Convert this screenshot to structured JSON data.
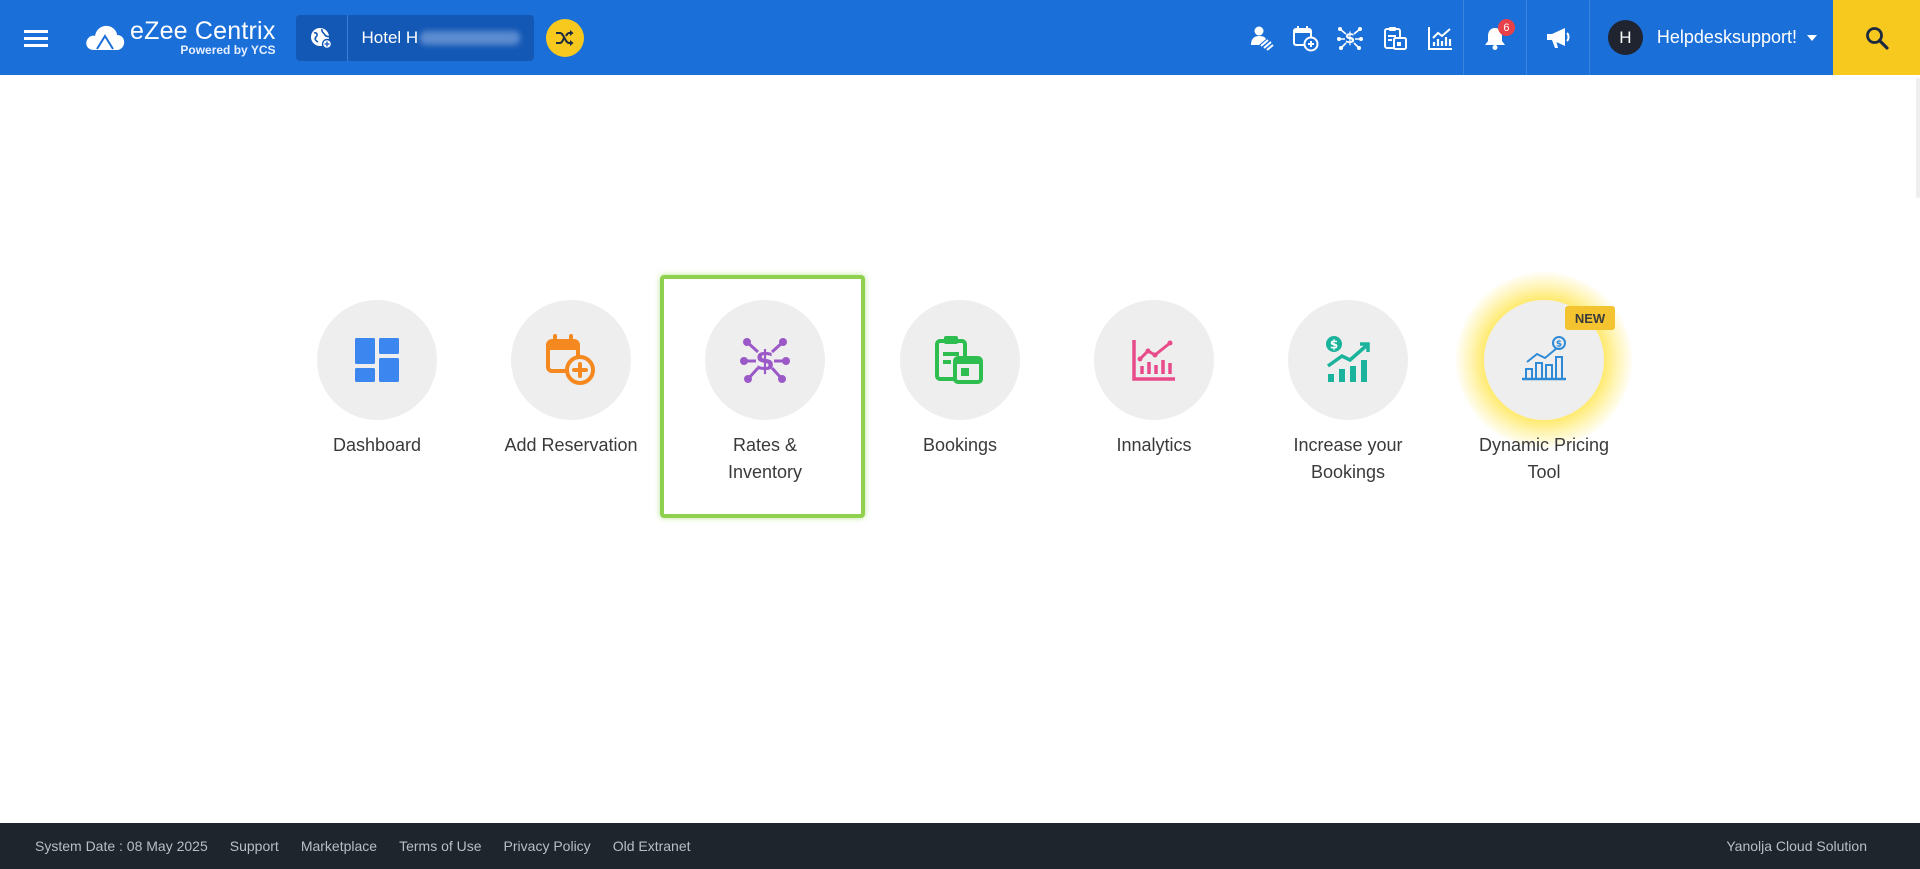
{
  "header": {
    "logo_main": "eZee Centrix",
    "logo_sub": "Powered by YCS",
    "hotel_name": "Hotel H",
    "notifications_count": "6",
    "user_initial": "H",
    "user_name": "Helpdesksupport!"
  },
  "tiles": [
    {
      "label": "Dashboard",
      "icon": "dashboard-icon",
      "color": "#3b86ef"
    },
    {
      "label": "Add Reservation",
      "icon": "calendar-add-icon",
      "color": "#f5891f"
    },
    {
      "label": "Rates &\nInventory",
      "icon": "rates-inventory-icon",
      "color": "#9b59c8"
    },
    {
      "label": "Bookings",
      "icon": "bookings-icon",
      "color": "#2ebe4f"
    },
    {
      "label": "Innalytics",
      "icon": "analytics-icon",
      "color": "#e84b8a"
    },
    {
      "label": "Increase your\nBookings",
      "icon": "growth-chart-icon",
      "color": "#1ab39b"
    },
    {
      "label": "Dynamic Pricing\nTool",
      "icon": "pricing-chart-icon",
      "color": "#2e8ad6",
      "badge": "NEW"
    }
  ],
  "footer": {
    "system_date": "System Date : 08 May 2025",
    "links": [
      "Support",
      "Marketplace",
      "Terms of Use",
      "Privacy Policy",
      "Old Extranet"
    ],
    "company": "Yanolja Cloud Solution"
  },
  "colors": {
    "header_bg": "#1a6fd9",
    "accent_yellow": "#f7c81e",
    "highlight_green": "#8fd14f",
    "footer_bg": "#1f252c"
  }
}
